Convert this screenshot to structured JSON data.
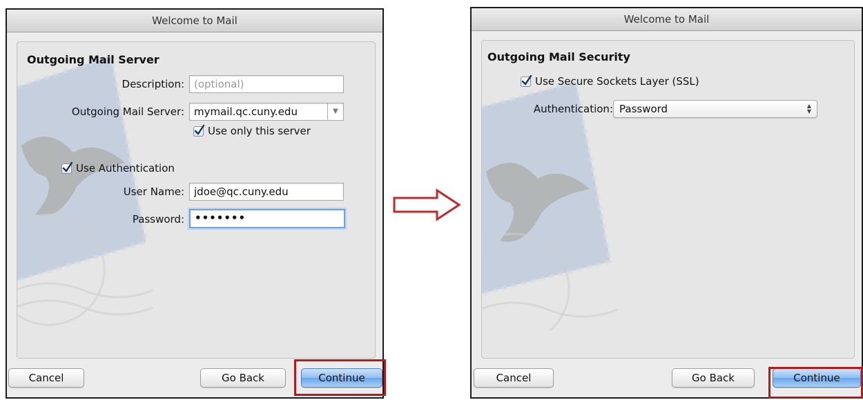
{
  "left_dialog": {
    "title": "Welcome to Mail",
    "heading": "Outgoing Mail Server",
    "description": {
      "label": "Description:",
      "value": "",
      "placeholder": "(optional)"
    },
    "server": {
      "label": "Outgoing Mail Server:",
      "value": "mymail.qc.cuny.edu",
      "arrow": "▼"
    },
    "use_only_server": {
      "label": "Use only this server",
      "checked": true
    },
    "use_authentication": {
      "label": "Use Authentication",
      "checked": true
    },
    "user_name": {
      "label": "User Name:",
      "value": "jdoe@qc.cuny.edu"
    },
    "password": {
      "label": "Password:",
      "value": "•••••••"
    },
    "buttons": {
      "cancel": "Cancel",
      "go_back": "Go Back",
      "continue": "Continue"
    }
  },
  "right_dialog": {
    "title": "Welcome to Mail",
    "heading": "Outgoing Mail Security",
    "use_ssl": {
      "label": "Use Secure Sockets Layer (SSL)",
      "checked": true
    },
    "authentication": {
      "label": "Authentication:",
      "value": "Password",
      "arrows": "▲\n▼"
    },
    "buttons": {
      "cancel": "Cancel",
      "go_back": "Go Back",
      "continue": "Continue"
    }
  },
  "colors": {
    "highlight_box": "#b11b1b",
    "arrow": "#c0282b",
    "default_button": "#6aa6ea",
    "focus_ring": "#6da2e4"
  },
  "icons": {
    "checkmark": "checkmark-icon",
    "flow_arrow": "right-arrow-icon",
    "background_art": "mail-eagle-stamp-icon"
  }
}
